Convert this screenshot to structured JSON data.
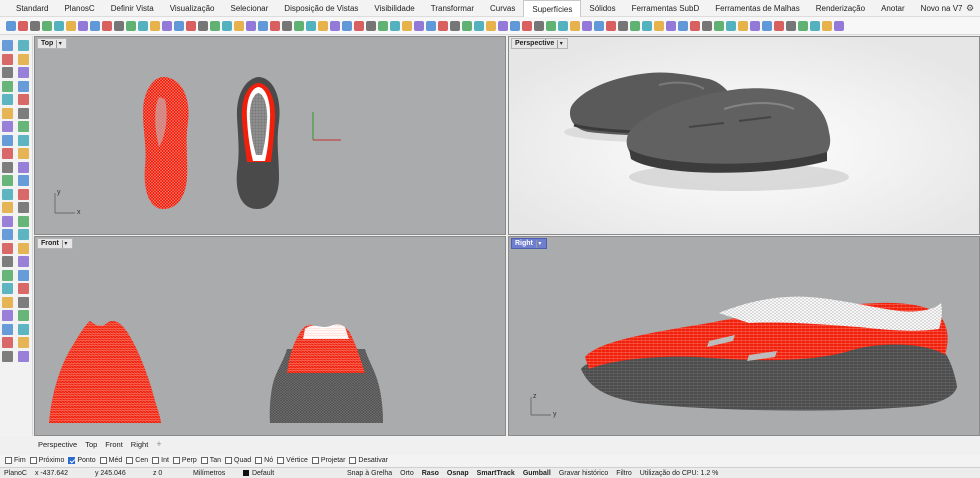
{
  "menu": {
    "tabs": [
      "Standard",
      "PlanosC",
      "Definir Vista",
      "Visualização",
      "Selecionar",
      "Disposição de Vistas",
      "Visibilidade",
      "Transformar",
      "Curvas",
      "Superfícies",
      "Sólidos",
      "Ferramentas SubD",
      "Ferramentas de Malhas",
      "Renderização",
      "Anotar",
      "Novo na V7"
    ],
    "active_tab": "Superfícies",
    "settings_icon": "gear-icon"
  },
  "viewports": {
    "top": {
      "title": "Top",
      "axis_y": "y",
      "axis_x": "x"
    },
    "perspective": {
      "title": "Perspective"
    },
    "front": {
      "title": "Front"
    },
    "right": {
      "title": "Right",
      "axis_y": "z",
      "axis_x": "y"
    }
  },
  "viewport_tabs": [
    "Perspective",
    "Top",
    "Front",
    "Right"
  ],
  "osnap": [
    {
      "label": "Fim",
      "checked": false
    },
    {
      "label": "Próximo",
      "checked": false
    },
    {
      "label": "Ponto",
      "checked": true
    },
    {
      "label": "Méd",
      "checked": false
    },
    {
      "label": "Cen",
      "checked": false
    },
    {
      "label": "Int",
      "checked": false
    },
    {
      "label": "Perp",
      "checked": false
    },
    {
      "label": "Tan",
      "checked": false
    },
    {
      "label": "Quad",
      "checked": false
    },
    {
      "label": "Nó",
      "checked": false
    },
    {
      "label": "Vértice",
      "checked": false
    },
    {
      "label": "Projetar",
      "checked": false
    },
    {
      "label": "Desativar",
      "checked": false
    }
  ],
  "status": {
    "cplane": "PlanoC",
    "x": "x -437.642",
    "y": "y 245.046",
    "z": "z 0",
    "units": "Milímetros",
    "layer": "Default",
    "snap": "Snap à Grelha",
    "ortho": "Orto",
    "planar": "Raso",
    "osnap": "Osnap",
    "smarttrack": "SmartTrack",
    "gumball": "Gumball",
    "history": "Gravar histórico",
    "filter": "Filtro",
    "cpu": "Utilização do CPU: 1.2 %"
  },
  "colors": {
    "viewport_bg": "#a9abad",
    "perspective_bg": "#f1f1f1",
    "surface_red": "#f0200c",
    "mesh_dark": "#4a4a4a",
    "active_title": "#6f7fd0"
  }
}
